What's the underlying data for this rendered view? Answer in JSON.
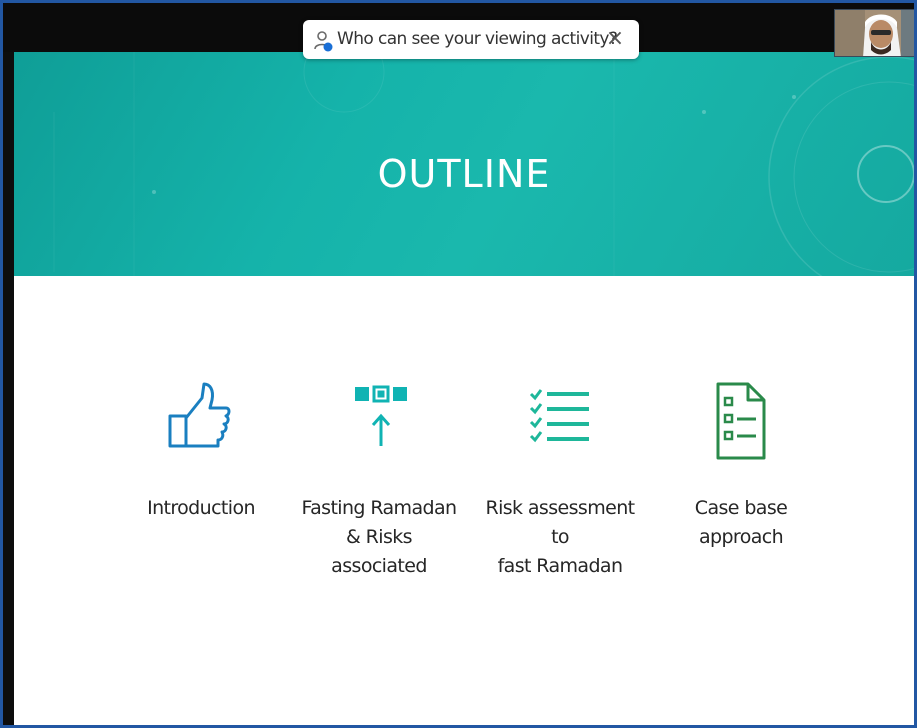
{
  "notification": {
    "text": "Who can see your viewing activity?",
    "close_label": "×"
  },
  "slide": {
    "title": "OUTLINE",
    "items": [
      {
        "label": "Introduction",
        "icon": "thumbs-up-icon",
        "color": "#1a7fc0"
      },
      {
        "label": "Fasting Ramadan\n& Risks associated",
        "icon": "boxes-arrow-up-icon",
        "color": "#10b3b3"
      },
      {
        "label": "Risk assessment to\nfast Ramadan",
        "icon": "checklist-icon",
        "color": "#1eb79a"
      },
      {
        "label": "Case base\napproach",
        "icon": "document-form-icon",
        "color": "#2a8a4a"
      }
    ]
  },
  "colors": {
    "banner": "#15b3aa",
    "frame": "#2257a3",
    "notification_icon": "#1a6fd6"
  }
}
